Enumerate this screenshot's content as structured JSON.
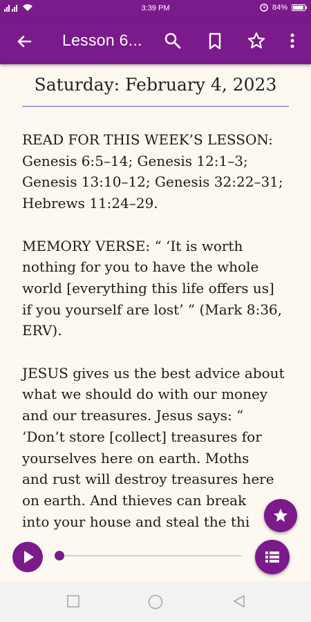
{
  "status_bar": {
    "time": "3:39 PM",
    "battery": "84%"
  },
  "app_bar": {
    "title": "Lesson 6...",
    "icons": [
      "back-arrow-icon",
      "search-icon",
      "bookmark-icon",
      "star-icon",
      "more-vert-icon"
    ]
  },
  "content": {
    "date": "Saturday: February 4, 2023",
    "lines": [
      [
        "READ FOR THIS WEEK’S LESSON:",
        "Genesis 6:5–14; Genesis 12:1–3;",
        "Genesis 13:10–12; Genesis 32:22–31;",
        "Hebrews 11:24–29."
      ],
      [
        "MEMORY VERSE: “ ‘It is worth",
        "nothing for you to have the whole",
        "world [everything this life offers us]",
        "if you yourself are lost’ ” (Mark 8:36,",
        "ERV)."
      ],
      [
        "JESUS gives us the best advice about",
        "what we should do with our money",
        "and our treasures. Jesus says: “",
        "‘Don’t store [collect] treasures for",
        "yourselves here on earth. Moths",
        "and rust will destroy treasures here",
        "on earth. And thieves can break",
        "into your house and steal the thi"
      ]
    ]
  },
  "player": {
    "progress": 0.0
  },
  "colors": {
    "primary": "#7b1a8b",
    "background": "#fdf9f0"
  }
}
